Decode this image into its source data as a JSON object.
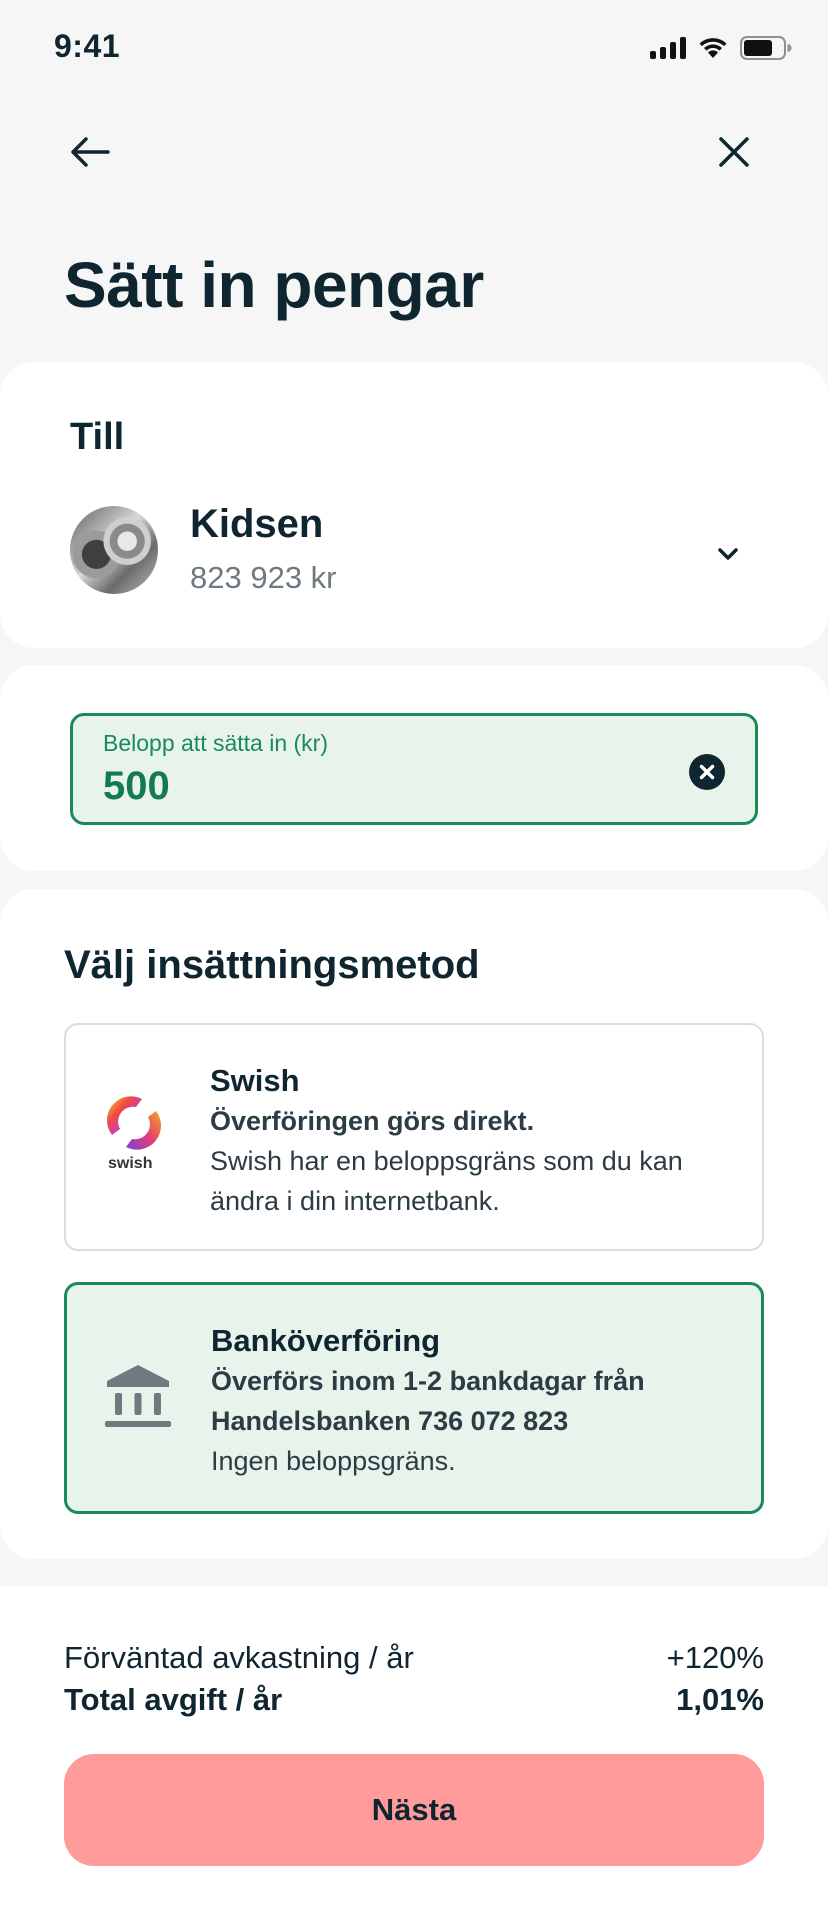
{
  "status_bar": {
    "time": "9:41",
    "icons": [
      "signal-icon",
      "wifi-icon",
      "battery-icon"
    ]
  },
  "nav": {
    "back_icon": "arrow-left-icon",
    "close_icon": "close-icon"
  },
  "page": {
    "title": "Sätt in pengar"
  },
  "to_section": {
    "label": "Till",
    "account": {
      "name": "Kidsen",
      "balance": "823 923 kr"
    },
    "chevron_icon": "chevron-down-icon"
  },
  "amount": {
    "label": "Belopp att sätta in (kr)",
    "value": "500",
    "clear_icon": "clear-icon"
  },
  "deposit_method": {
    "title": "Välj insättningsmetod",
    "options": [
      {
        "name": "Swish",
        "sub": "Överföringen görs direkt.",
        "desc": "Swish har en beloppsgräns som du kan ändra i din internetbank.",
        "icon": "swish-logo-icon",
        "logo_text": "swish",
        "selected": false
      },
      {
        "name": "Banköverföring",
        "sub": "Överförs inom 1-2 bankdagar från Handelsbanken 736 072 823",
        "desc": "Ingen beloppsgräns.",
        "icon": "bank-icon",
        "selected": true
      }
    ]
  },
  "summary": {
    "return_label": "Förväntad avkastning / år",
    "return_value": "+120%",
    "fee_label": "Total avgift / år",
    "fee_value": "1,01%"
  },
  "actions": {
    "next_label": "Nästa"
  },
  "colors": {
    "accent_green": "#1b8a5a",
    "selected_bg": "#e8f3ec",
    "primary_button": "#ff9b9b",
    "text_dark": "#0f2530"
  }
}
